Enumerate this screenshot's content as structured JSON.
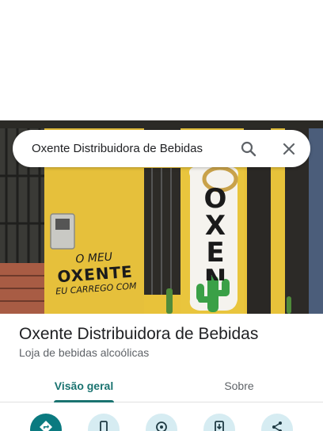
{
  "search": {
    "query": "Oxente Distribuidora de Bebidas",
    "search_icon": "search-icon",
    "close_icon": "close-icon"
  },
  "photo": {
    "sign_lines": [
      "O MEU",
      "OXENTE",
      "EU CARREGO COM"
    ],
    "sign_vertical": "OXENTE",
    "colors": {
      "wall": "#e8c23a",
      "sign_black": "#1b1b1b",
      "cactus": "#3aa047"
    }
  },
  "place": {
    "name": "Oxente Distribuidora de Bebidas",
    "category": "Loja de bebidas alcoólicas"
  },
  "tabs": [
    {
      "label": "Visão geral",
      "active": true
    },
    {
      "label": "Sobre",
      "active": false
    }
  ],
  "actions": [
    {
      "icon": "directions-icon"
    },
    {
      "icon": "phone-icon"
    },
    {
      "icon": "nearby-icon"
    },
    {
      "icon": "send-to-phone-icon"
    },
    {
      "icon": "share-icon"
    }
  ],
  "colors": {
    "accent": "#1a7370",
    "action_bg": "#d6ecf2",
    "action_primary": "#0b7a80"
  }
}
